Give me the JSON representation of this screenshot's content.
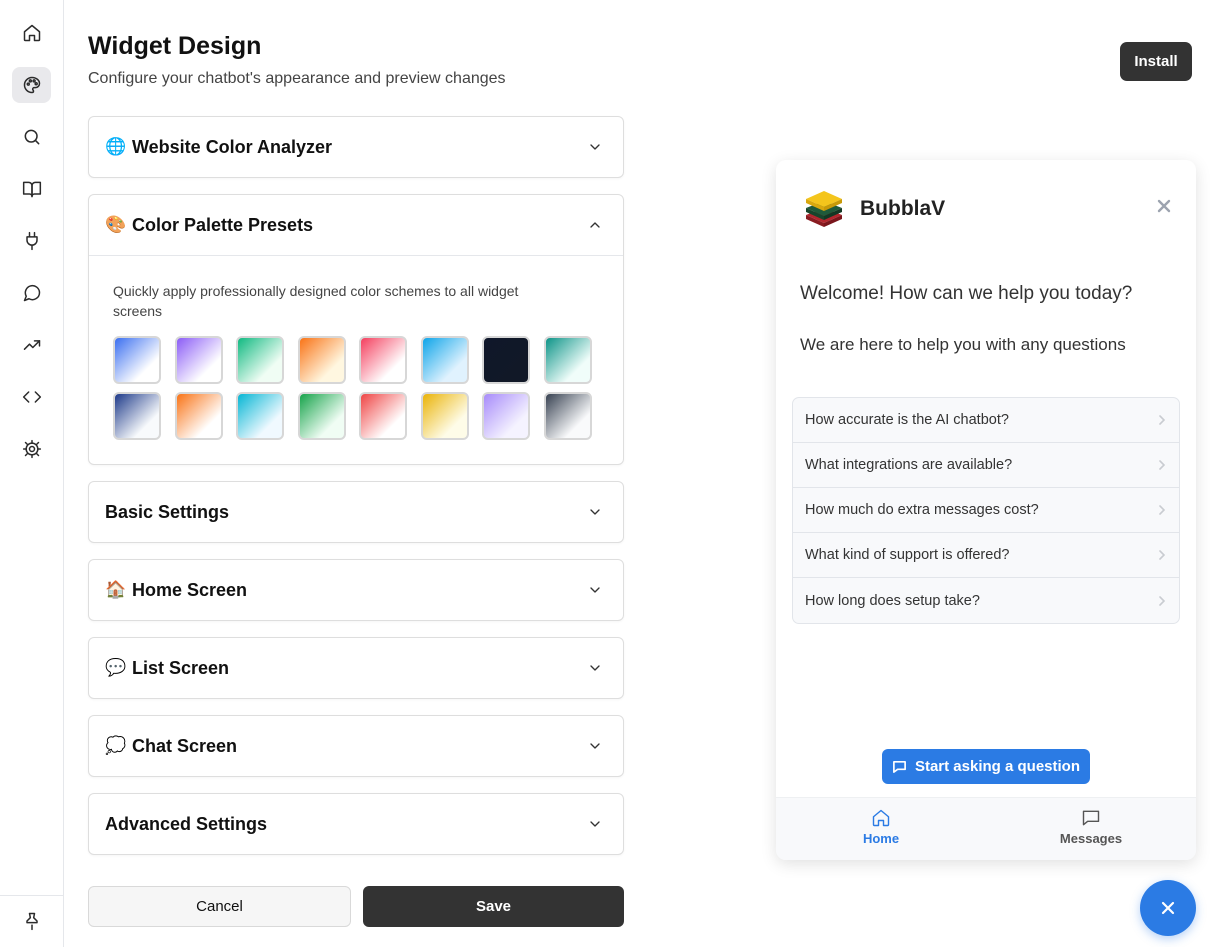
{
  "sidebar": {
    "items": [
      {
        "icon": "home-icon"
      },
      {
        "icon": "palette-icon",
        "active": true
      },
      {
        "icon": "search-icon"
      },
      {
        "icon": "book-icon"
      },
      {
        "icon": "plug-icon"
      },
      {
        "icon": "message-circle-icon"
      },
      {
        "icon": "trending-up-icon"
      },
      {
        "icon": "code-icon"
      },
      {
        "icon": "settings-icon"
      }
    ],
    "bottom_icon": "pin-icon"
  },
  "header": {
    "title": "Widget Design",
    "subtitle": "Configure your chatbot's appearance and preview changes",
    "install_label": "Install"
  },
  "sections": [
    {
      "emoji": "🌐",
      "title": "Website Color Analyzer",
      "expanded": false
    },
    {
      "emoji": "🎨",
      "title": "Color Palette Presets",
      "expanded": true,
      "description": "Quickly apply professionally designed color schemes to all widget screens"
    },
    {
      "emoji": "",
      "title": "Basic Settings",
      "expanded": false
    },
    {
      "emoji": "🏠",
      "title": "Home Screen",
      "expanded": false
    },
    {
      "emoji": "💬",
      "title": "List Screen",
      "expanded": false
    },
    {
      "emoji": "💭",
      "title": "Chat Screen",
      "expanded": false
    },
    {
      "emoji": "",
      "title": "Advanced Settings",
      "expanded": false
    }
  ],
  "palette_presets": [
    {
      "from": "#3b6ff0",
      "to": "#ffffff"
    },
    {
      "from": "#8b5cf6",
      "to": "#ffffff"
    },
    {
      "from": "#10b981",
      "to": "#f0fdf4"
    },
    {
      "from": "#f97316",
      "to": "#fff7e0"
    },
    {
      "from": "#f43f5e",
      "to": "#ffffff"
    },
    {
      "from": "#0ea5e9",
      "to": "#e0f2fe"
    },
    {
      "from": "#0f172a",
      "to": "#111827"
    },
    {
      "from": "#0d9488",
      "to": "#f0fdfa"
    },
    {
      "from": "#1e3a8a",
      "to": "#f8fafc"
    },
    {
      "from": "#f97316",
      "to": "#ffffff"
    },
    {
      "from": "#06b6d4",
      "to": "#f0f9ff"
    },
    {
      "from": "#16a34a",
      "to": "#f0fdf4"
    },
    {
      "from": "#ef4444",
      "to": "#ffffff"
    },
    {
      "from": "#eab308",
      "to": "#fefce8"
    },
    {
      "from": "#a78bfa",
      "to": "#f5f3ff"
    },
    {
      "from": "#374151",
      "to": "#f9fafb"
    }
  ],
  "actions": {
    "cancel_label": "Cancel",
    "save_label": "Save"
  },
  "preview": {
    "bot_name": "BubblaV",
    "welcome": "Welcome! How can we help you today?",
    "subtitle": "We are here to help you with any questions",
    "faqs": [
      "How accurate is the AI chatbot?",
      "What integrations are available?",
      "How much do extra messages cost?",
      "What kind of support is offered?",
      "How long does setup take?"
    ],
    "start_label": "Start asking a question",
    "nav": {
      "home_label": "Home",
      "messages_label": "Messages"
    },
    "colors": {
      "accent": "#2b7be4",
      "nav_inactive": "#555555"
    }
  }
}
